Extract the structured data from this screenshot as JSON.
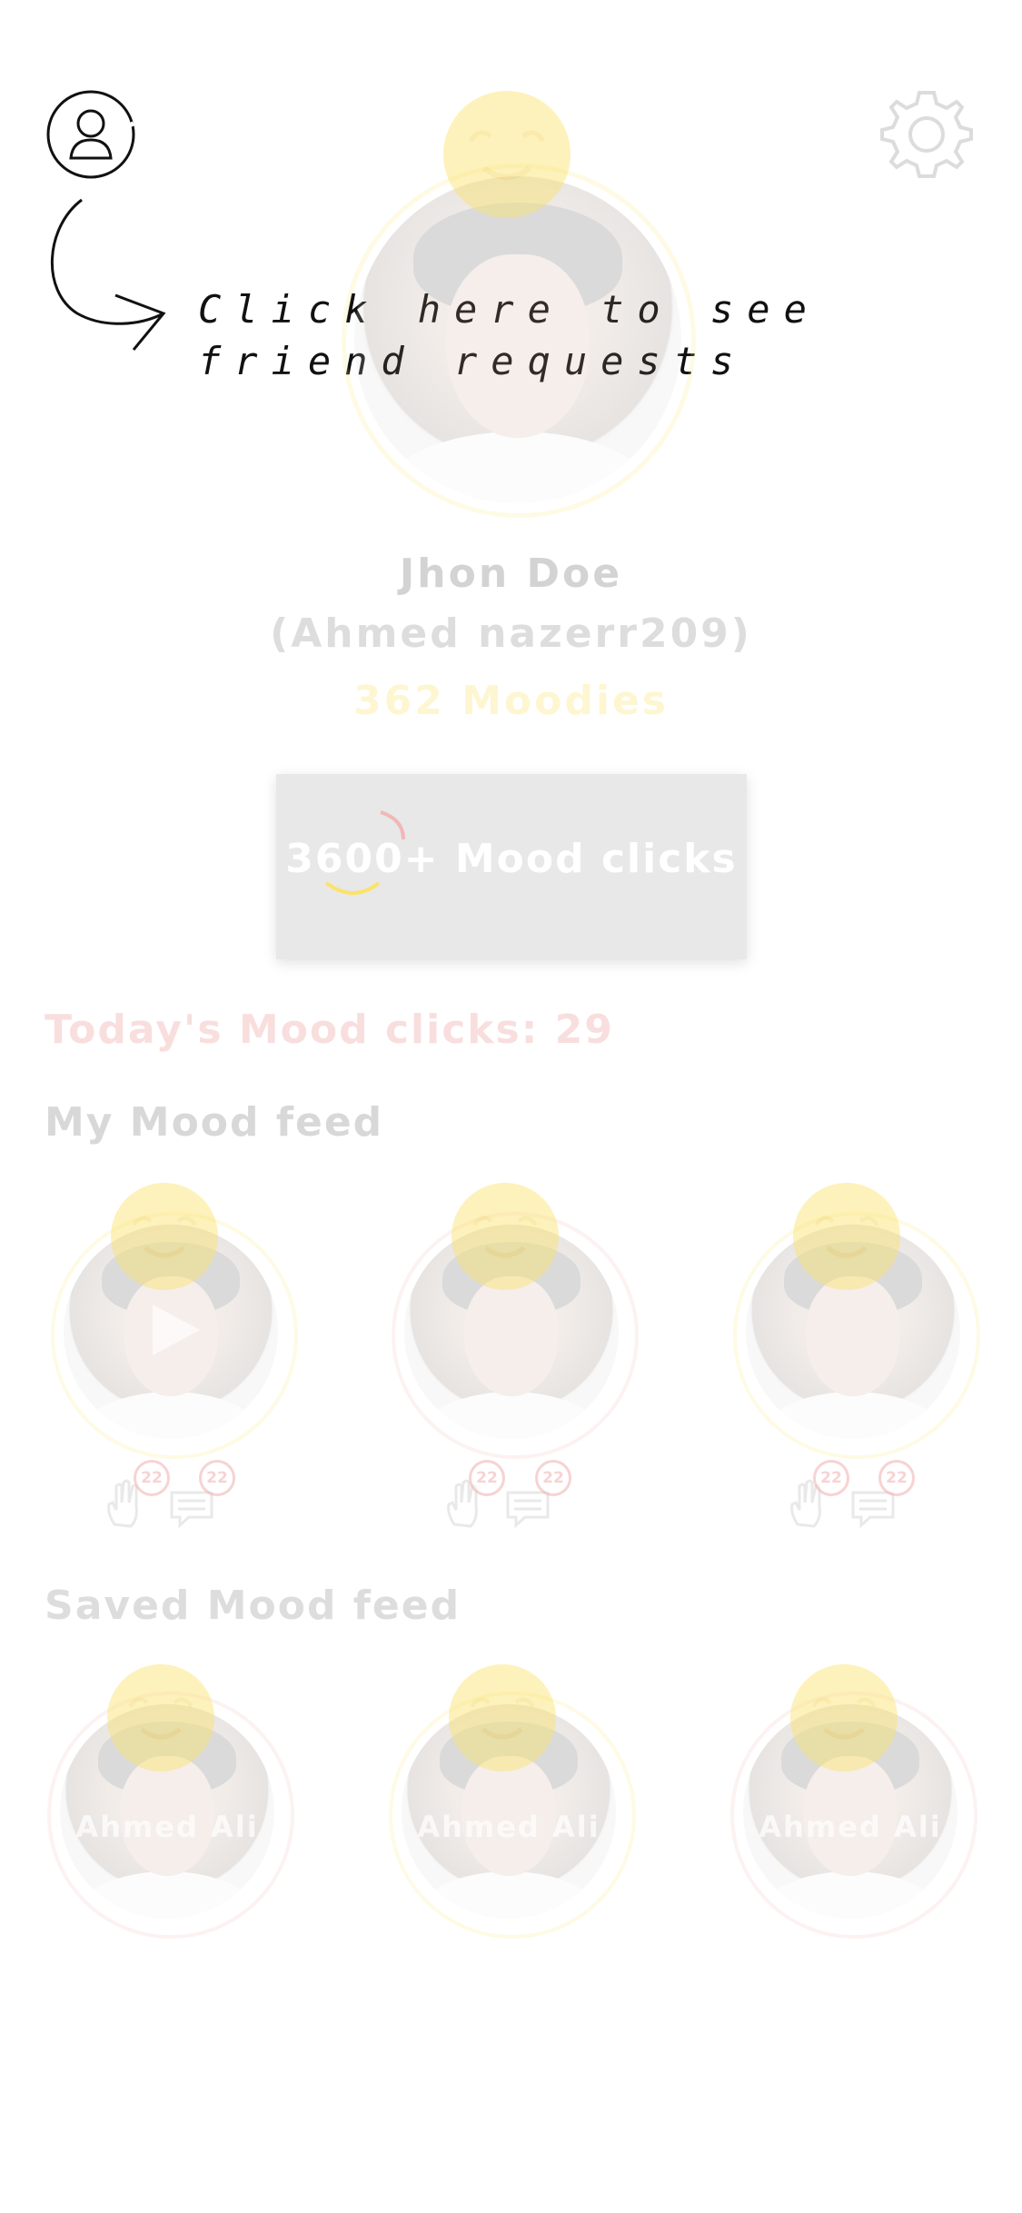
{
  "tooltip": {
    "line1": "Click here to see",
    "line2": "friend requests"
  },
  "profile": {
    "display_name": "Jhon Doe",
    "username": "(Ahmed nazerr209)",
    "moodies": "362 Moodies"
  },
  "mood_clicks_button": {
    "label": "3600+ Mood clicks"
  },
  "today": {
    "label": "Today's Mood clicks: 29"
  },
  "my_feed": {
    "title": "My Mood feed",
    "items": [
      {
        "likes": "22",
        "comments": "22",
        "has_video": true
      },
      {
        "likes": "22",
        "comments": "22",
        "has_video": false
      },
      {
        "likes": "22",
        "comments": "22",
        "has_video": false
      }
    ]
  },
  "saved_feed": {
    "title": "Saved Mood feed",
    "items": [
      {
        "name": "Ahmed Ali"
      },
      {
        "name": "Ahmed Ali"
      },
      {
        "name": "Ahmed Ali"
      }
    ]
  },
  "colors": {
    "accent_yellow": "#fbe36a",
    "accent_red": "#f2b7b7",
    "overlay_gray": "#e8e8e8"
  },
  "icons": {
    "friends": "person-outline-icon",
    "settings": "gear-icon",
    "arrow": "curved-arrow-icon",
    "like": "hand-icon",
    "comment": "chat-bubble-icon",
    "play": "play-icon",
    "smiley": "smiley-face-icon"
  }
}
